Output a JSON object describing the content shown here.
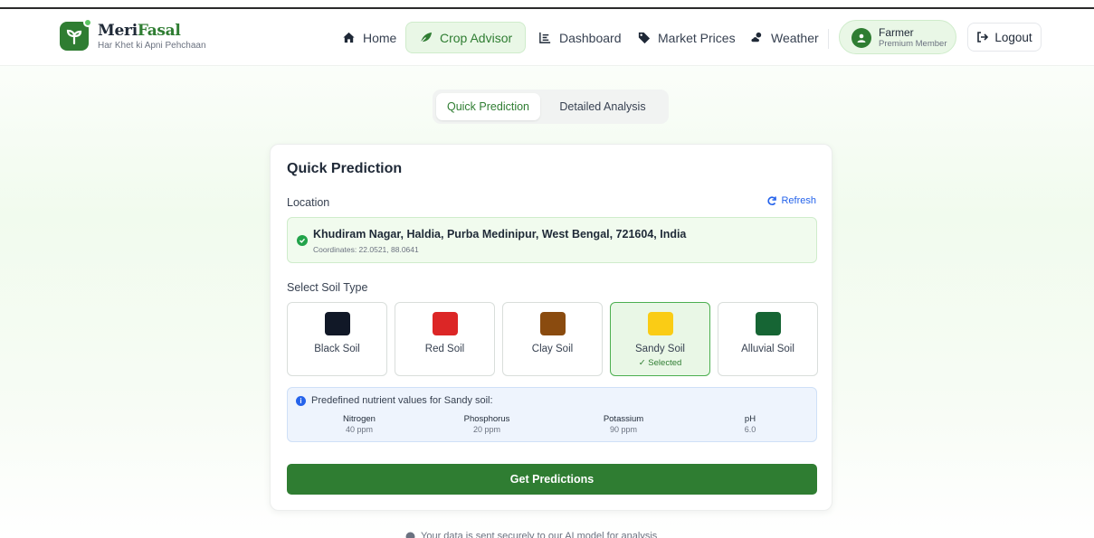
{
  "brand": {
    "name_part1": "Meri",
    "name_part2": "Fasal",
    "tagline": "Har Khet ki Apni Pehchaan"
  },
  "nav": {
    "items": [
      {
        "label": "Home",
        "icon": "home-icon"
      },
      {
        "label": "Crop Advisor",
        "icon": "leaf-icon",
        "active": true
      },
      {
        "label": "Dashboard",
        "icon": "dashboard-icon"
      },
      {
        "label": "Market Prices",
        "icon": "tag-icon"
      },
      {
        "label": "Weather",
        "icon": "cloud-sun-icon"
      }
    ],
    "user": {
      "name": "Farmer",
      "role": "Premium Member"
    },
    "logout_label": "Logout"
  },
  "tabs": {
    "quick": "Quick Prediction",
    "detailed": "Detailed Analysis",
    "active": "quick"
  },
  "card": {
    "title": "Quick Prediction",
    "location_label": "Location",
    "refresh_label": "Refresh",
    "address": "Khudiram Nagar, Haldia, Purba Medinipur, West Bengal, 721604, India",
    "coordinates": "Coordinates: 22.0521, 88.0641",
    "soil_label": "Select Soil Type",
    "soils": [
      {
        "name": "Black Soil",
        "color": "#111827"
      },
      {
        "name": "Red Soil",
        "color": "#dc2626"
      },
      {
        "name": "Clay Soil",
        "color": "#8a4b0f"
      },
      {
        "name": "Sandy Soil",
        "color": "#facc15",
        "selected": true
      },
      {
        "name": "Alluvial Soil",
        "color": "#166534"
      }
    ],
    "selected_label": "✓ Selected",
    "nutrients_title": "Predefined nutrient values for Sandy soil:",
    "nutrients": [
      {
        "name": "Nitrogen",
        "value": "40 ppm"
      },
      {
        "name": "Phosphorus",
        "value": "20 ppm"
      },
      {
        "name": "Potassium",
        "value": "90 ppm"
      },
      {
        "name": "pH",
        "value": "6.0"
      }
    ],
    "button_label": "Get Predictions"
  },
  "footer_note": "Your data is sent securely to our AI model for analysis",
  "colors": {
    "primary": "#2f7d32",
    "accent_blue": "#2563eb"
  }
}
